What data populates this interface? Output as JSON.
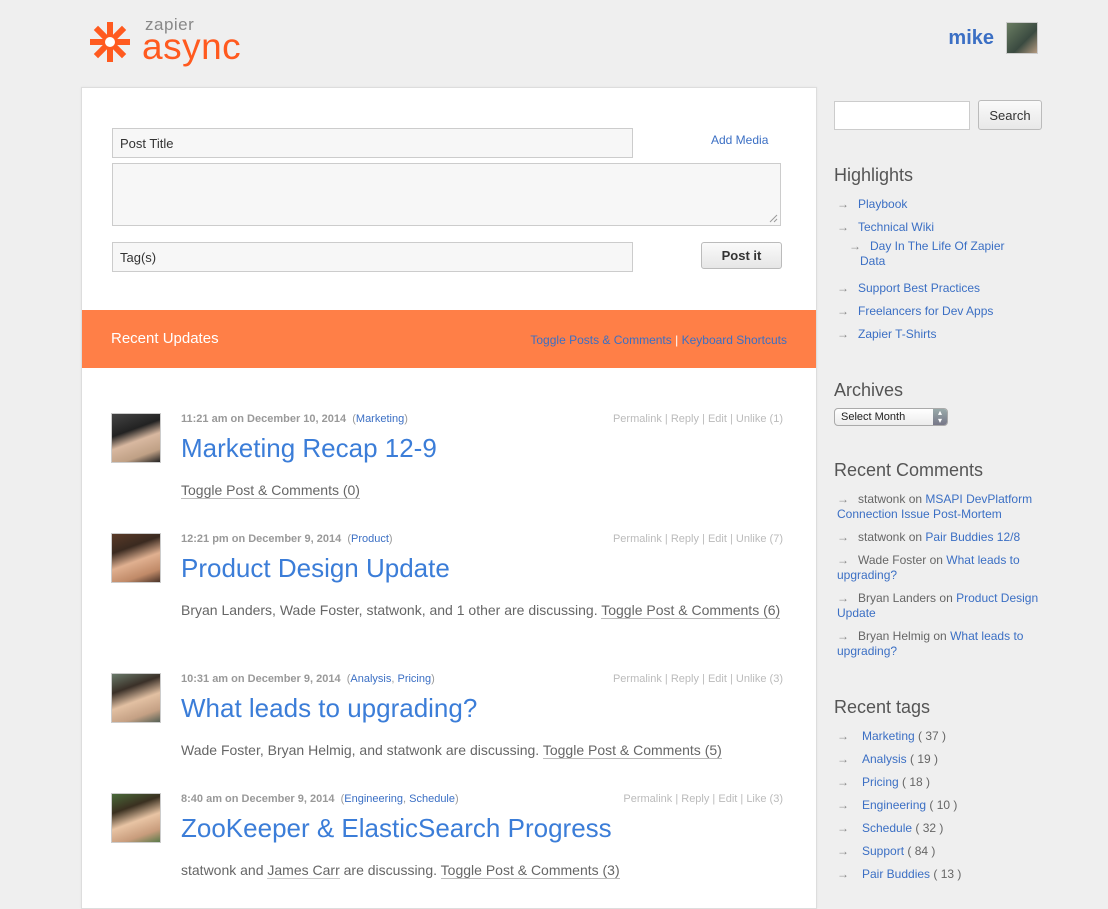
{
  "header": {
    "logo_small": "zapier",
    "logo_big": "async",
    "user_name": "mike"
  },
  "composer": {
    "title_placeholder": "Post Title",
    "add_media": "Add Media",
    "tags_placeholder": "Tag(s)",
    "post_button": "Post it"
  },
  "updates": {
    "title": "Recent Updates",
    "toggle_link": "Toggle Posts & Comments",
    "separator": "|",
    "shortcuts_link": "Keyboard Shortcuts"
  },
  "posts": [
    {
      "meta": "11:21 am on December 10, 2014",
      "cats": [
        "Marketing"
      ],
      "permalink": "Permalink",
      "reply": "Reply",
      "edit": "Edit",
      "like": "Unlike (1)",
      "title": "Marketing Recap 12-9",
      "discuss": "",
      "toggle": "Toggle Post & Comments (0)"
    },
    {
      "meta": "12:21 pm on December 9, 2014",
      "cats": [
        "Product"
      ],
      "permalink": "Permalink",
      "reply": "Reply",
      "edit": "Edit",
      "like": "Unlike (7)",
      "title": "Product Design Update",
      "discuss": "Bryan Landers, Wade Foster, statwonk, and 1 other are discussing.",
      "toggle": "Toggle Post & Comments (6)"
    },
    {
      "meta": "10:31 am on December 9, 2014",
      "cats": [
        "Analysis",
        "Pricing"
      ],
      "permalink": "Permalink",
      "reply": "Reply",
      "edit": "Edit",
      "like": "Unlike (3)",
      "title": "What leads to upgrading?",
      "discuss": "Wade Foster, Bryan Helmig, and statwonk are discussing.",
      "toggle": "Toggle Post & Comments (5)"
    },
    {
      "meta": "8:40 am on December 9, 2014",
      "cats": [
        "Engineering",
        "Schedule"
      ],
      "permalink": "Permalink",
      "reply": "Reply",
      "edit": "Edit",
      "like": "Like (3)",
      "title": "ZooKeeper & ElasticSearch Progress",
      "discuss_a": "statwonk and",
      "discuss_person": "James Carr",
      "discuss_b": "are discussing.",
      "toggle": "Toggle Post & Comments (3)"
    }
  ],
  "sidebar": {
    "search_button": "Search",
    "highlights_title": "Highlights",
    "highlights": [
      "Playbook",
      "Technical Wiki",
      "Day In The Life Of Zapier",
      "Data",
      "Support Best Practices",
      "Freelancers for Dev Apps",
      "Zapier T-Shirts"
    ],
    "archives_title": "Archives",
    "archives_select": "Select Month",
    "comments_title": "Recent Comments",
    "comments": [
      {
        "who": "statwonk",
        "on": "on",
        "what": "MSAPI DevPlatform Connection Issue Post-Mortem"
      },
      {
        "who": "statwonk",
        "on": "on",
        "what": "Pair Buddies 12/8"
      },
      {
        "who": "Wade Foster",
        "on": "on",
        "what": "What leads to upgrading?"
      },
      {
        "who": "Bryan Landers",
        "on": "on",
        "what": "Product Design Update"
      },
      {
        "who": "Bryan Helmig",
        "on": "on",
        "what": "What leads to upgrading?"
      }
    ],
    "tags_title": "Recent tags",
    "tags": [
      {
        "name": "Marketing",
        "count": "( 37 )"
      },
      {
        "name": "Analysis",
        "count": "( 19 )"
      },
      {
        "name": "Pricing",
        "count": "( 18 )"
      },
      {
        "name": "Engineering",
        "count": "( 10 )"
      },
      {
        "name": "Schedule",
        "count": "( 32 )"
      },
      {
        "name": "Support",
        "count": "( 84 )"
      },
      {
        "name": "Pair Buddies",
        "count": "( 13 )"
      }
    ],
    "arrow": "→"
  }
}
